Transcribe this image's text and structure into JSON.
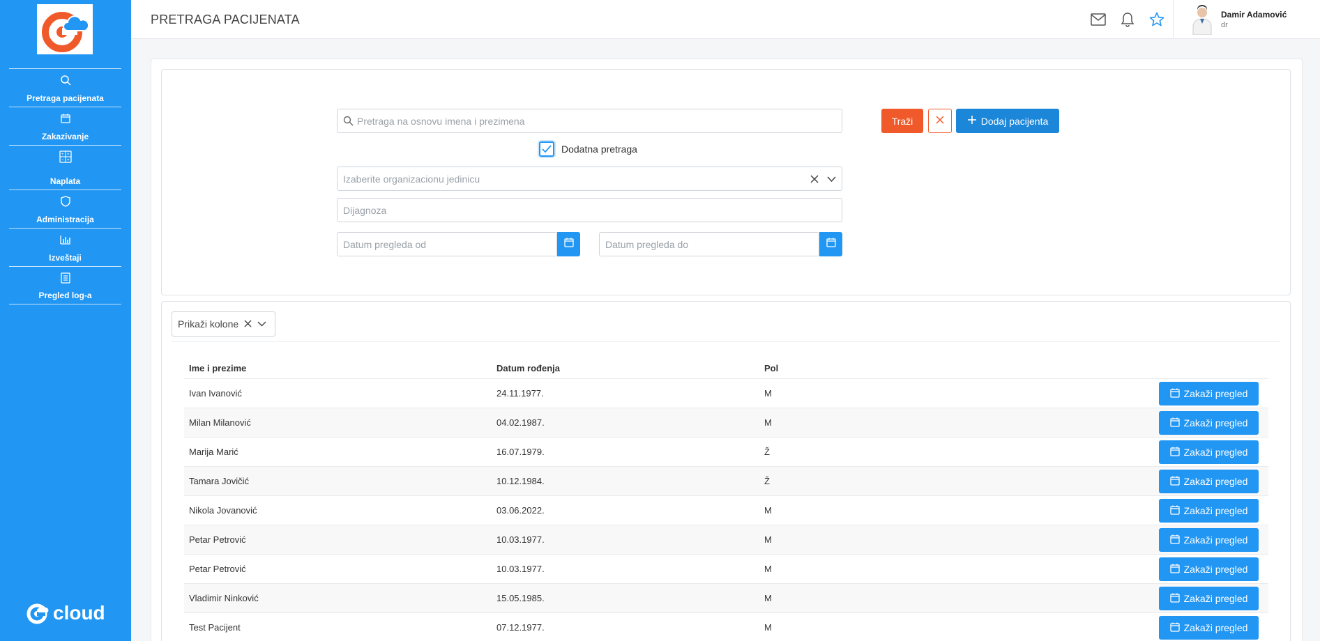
{
  "sidebar": {
    "items": [
      {
        "label": "Pretraga pacijenata",
        "icon": "search-icon"
      },
      {
        "label": "Zakazivanje",
        "icon": "calendar-icon"
      },
      {
        "label": "Naplata",
        "icon": "calculator-icon"
      },
      {
        "label": "Administracija",
        "icon": "shield-icon"
      },
      {
        "label": "Izveštaji",
        "icon": "bar-chart-icon"
      },
      {
        "label": "Pregled log-a",
        "icon": "log-icon"
      }
    ],
    "footer_logo": "cloud"
  },
  "header": {
    "title": "PRETRAGA PACIJENATA",
    "user_name": "Damir Adamović",
    "user_role": "dr"
  },
  "search": {
    "name_placeholder": "Pretraga na osnovu imena i prezimena",
    "search_button": "Traži",
    "add_button": "Dodaj pacijenta",
    "extra_search_label": "Dodatna pretraga",
    "extra_search_checked": true,
    "org_placeholder": "Izaberite organizacionu jedinicu",
    "diagnosis_placeholder": "Dijagnoza",
    "date_from_placeholder": "Datum pregleda od",
    "date_to_placeholder": "Datum pregleda do"
  },
  "table": {
    "columns_dropdown": "Prikaži kolone",
    "headers": [
      "Ime i prezime",
      "Datum rođenja",
      "Pol"
    ],
    "action_label": "Zakaži pregled",
    "rows": [
      [
        "Ivan Ivanović",
        "24.11.1977.",
        "M"
      ],
      [
        "Milan Milanović",
        "04.02.1987.",
        "M"
      ],
      [
        "Marija Marić",
        "16.07.1979.",
        "Ž"
      ],
      [
        "Tamara Jovičić",
        "10.12.1984.",
        "Ž"
      ],
      [
        "Nikola Jovanović",
        "03.06.2022.",
        "M"
      ],
      [
        "Petar Petrović",
        "10.03.1977.",
        "M"
      ],
      [
        "Petar Petrović",
        "10.03.1977.",
        "M"
      ],
      [
        "Vladimir Ninković",
        "15.05.1985.",
        "M"
      ],
      [
        "Test Pacijent",
        "07.12.1977.",
        "M"
      ]
    ]
  },
  "colors": {
    "primary": "#2196f3",
    "accent": "#f05a2a",
    "add": "#1c86d8"
  }
}
